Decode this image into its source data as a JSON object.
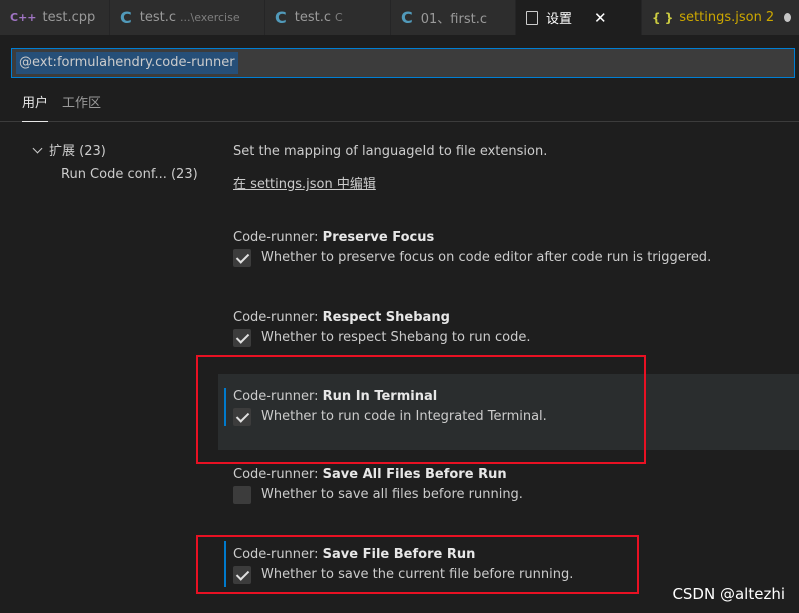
{
  "tabs": [
    {
      "label": "test.cpp",
      "icon": "cpp-file-icon",
      "desc": ""
    },
    {
      "label": "test.c",
      "icon": "c-file-icon",
      "desc": "...\\exercise"
    },
    {
      "label": "test.c",
      "icon": "c-file-icon",
      "desc": "C"
    },
    {
      "label": "01、first.c",
      "icon": "c-file-icon",
      "desc": ""
    },
    {
      "label": "设置",
      "icon": "settings-file-icon",
      "desc": ""
    },
    {
      "label": "settings.json",
      "icon": "json-file-icon",
      "badge": "2"
    }
  ],
  "search": {
    "value": "@ext:formulahendry.code-runner"
  },
  "scope_tabs": {
    "user": "用户",
    "workspace": "工作区"
  },
  "toc": {
    "extensions_label": "扩展",
    "extensions_count": "(23)",
    "run_code_label": "Run Code conf...",
    "run_code_count": "(23)"
  },
  "executor_map": {
    "desc": "Set the mapping of languageId to file extension.",
    "link": "在 settings.json 中编辑"
  },
  "settings": [
    {
      "prefix": "Code-runner: ",
      "name": "Preserve Focus",
      "desc": "Whether to preserve focus on code editor after code run is triggered.",
      "checked": true
    },
    {
      "prefix": "Code-runner: ",
      "name": "Respect Shebang",
      "desc": "Whether to respect Shebang to run code.",
      "checked": true
    },
    {
      "prefix": "Code-runner: ",
      "name": "Run In Terminal",
      "desc": "Whether to run code in Integrated Terminal.",
      "checked": true
    },
    {
      "prefix": "Code-runner: ",
      "name": "Save All Files Before Run",
      "desc": "Whether to save all files before running.",
      "checked": false
    },
    {
      "prefix": "Code-runner: ",
      "name": "Save File Before Run",
      "desc": "Whether to save the current file before running.",
      "checked": true
    }
  ],
  "watermark": "CSDN @altezhi",
  "colors": {
    "accent": "#007acc",
    "highlight_box": "#e81123",
    "background": "#1e1e1e"
  }
}
